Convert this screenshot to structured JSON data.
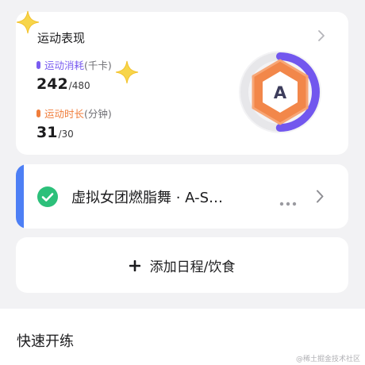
{
  "performance": {
    "title": "运动表现",
    "grade": "A",
    "grade_progress": 0.5,
    "metrics": [
      {
        "name": "运动消耗",
        "unit": "(千卡)",
        "current": "242",
        "target": "/480",
        "color": "#7a5cf0"
      },
      {
        "name": "运动时长",
        "unit": "(分钟)",
        "current": "31",
        "target": "/30",
        "color": "#f07e3c"
      }
    ]
  },
  "course": {
    "title": "虚拟女团燃脂舞 · A-S…",
    "check_color": "#2cc07a",
    "accent_color": "#4d7ff5"
  },
  "add": {
    "label": "添加日程/饮食"
  },
  "quick_start": {
    "title": "快速开练"
  },
  "watermark": "@稀土掘金技术社区",
  "icons": [
    "sparkle-star-icon",
    "chevron-right-icon",
    "check-circle-icon",
    "more-dots-icon",
    "plus-icon"
  ]
}
